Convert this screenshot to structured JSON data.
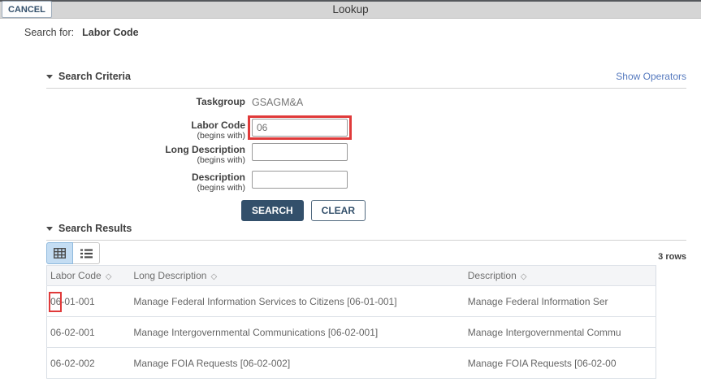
{
  "colors": {
    "accent_navy": "#33506B",
    "link_blue": "#5579BE",
    "annotation_red": "#E03A3A",
    "toggle_selected_bg": "#C4DDF3",
    "titlebar_bg": "#D5D5D5"
  },
  "icons": {
    "sort": "◇",
    "grid_view": "grid-icon",
    "list_view": "list-icon",
    "collapse_caret": "triangle-down"
  },
  "titlebar": {
    "cancel_label": "CANCEL",
    "title": "Lookup"
  },
  "search_for": {
    "label": "Search for:",
    "value": "Labor Code"
  },
  "criteria": {
    "title": "Search Criteria",
    "show_operators_link": "Show Operators",
    "taskgroup_label": "Taskgroup",
    "taskgroup_value": "GSAGM&A",
    "labor_code_label": "Labor Code",
    "labor_code_sublabel": "(begins with)",
    "labor_code_value": "06",
    "long_description_label": "Long Description",
    "long_description_sublabel": "(begins with)",
    "long_description_value": "",
    "description_label": "Description",
    "description_sublabel": "(begins with)",
    "description_value": "",
    "search_button": "SEARCH",
    "clear_button": "CLEAR"
  },
  "results": {
    "title": "Search Results",
    "row_count": "3 rows",
    "columns": [
      "Labor Code",
      "Long Description",
      "Description"
    ],
    "rows": [
      {
        "labor_code": "06-01-001",
        "long_description": "Manage Federal Information Services to Citizens [06-01-001]",
        "description": "Manage Federal Information Ser"
      },
      {
        "labor_code": "06-02-001",
        "long_description": "Manage Intergovernmental Communications [06-02-001]",
        "description": "Manage Intergovernmental Commu"
      },
      {
        "labor_code": "06-02-002",
        "long_description": "Manage FOIA Requests [06-02-002]",
        "description": "Manage FOIA Requests [06-02-00"
      }
    ]
  }
}
